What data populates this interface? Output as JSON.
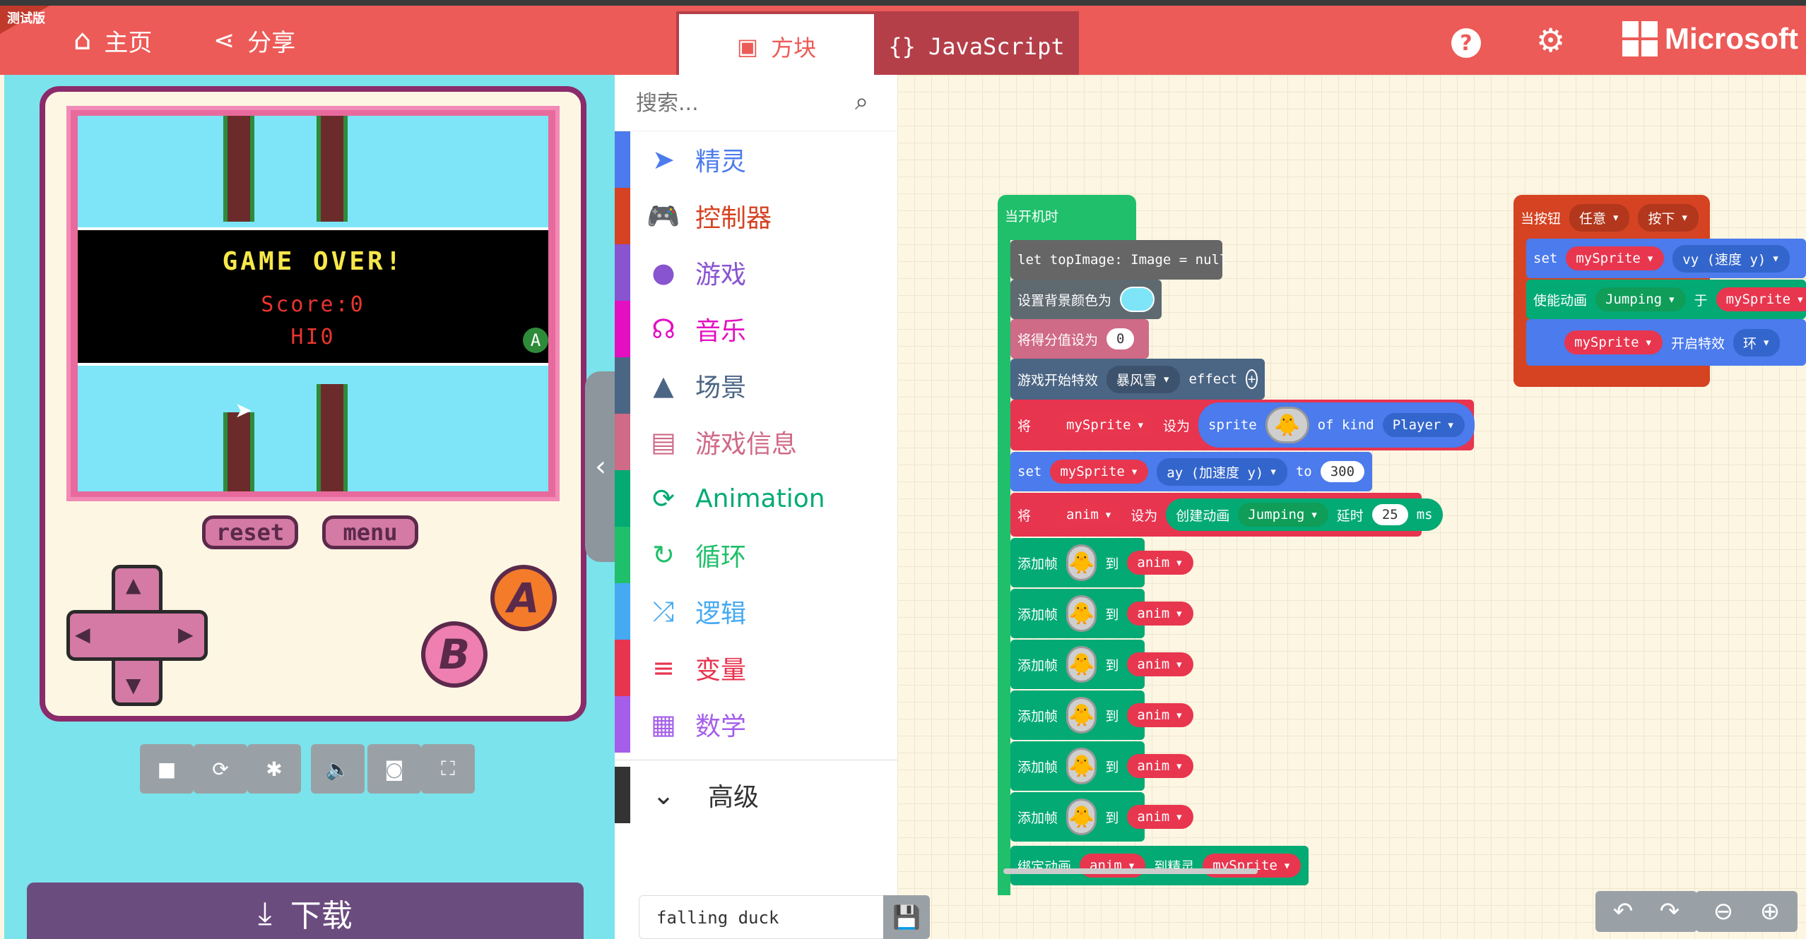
{
  "header": {
    "beta_label": "测试版",
    "home_label": "主页",
    "share_label": "分享",
    "tab_blocks": "方块",
    "tab_js": "JavaScript",
    "brand": "Microsoft",
    "accent": "#ec5b57"
  },
  "simulator": {
    "game_over": "GAME OVER!",
    "score": "Score:0",
    "hi": "HI0",
    "reset": "reset",
    "menu": "menu",
    "btn_a": "A",
    "btn_b": "B",
    "a_indicator": "A",
    "toolbar_icons": [
      "stop-icon",
      "restart-icon",
      "debug-icon",
      "sound-icon",
      "screenshot-icon",
      "fullscreen-icon"
    ],
    "download": "下载"
  },
  "toolbox": {
    "search_placeholder": "搜索...",
    "categories": [
      {
        "label": "精灵",
        "color": "#4b7bec",
        "icon": "paper-plane-icon"
      },
      {
        "label": "控制器",
        "color": "#d54322",
        "icon": "gamepad-icon"
      },
      {
        "label": "游戏",
        "color": "#8854d0",
        "icon": "circle-icon"
      },
      {
        "label": "音乐",
        "color": "#e30fc0",
        "icon": "headphones-icon"
      },
      {
        "label": "场景",
        "color": "#4b6584",
        "icon": "tree-icon"
      },
      {
        "label": "游戏信息",
        "color": "#cf6a87",
        "icon": "id-card-icon"
      },
      {
        "label": "Animation",
        "color": "#03aa74",
        "icon": "refresh-icon"
      },
      {
        "label": "循环",
        "color": "#20bf6b",
        "icon": "loop-icon"
      },
      {
        "label": "逻辑",
        "color": "#45aaf2",
        "icon": "shuffle-icon"
      },
      {
        "label": "变量",
        "color": "#e7344f",
        "icon": "list-icon"
      },
      {
        "label": "数学",
        "color": "#a55eea",
        "icon": "calculator-icon"
      }
    ],
    "advanced": "高级"
  },
  "workspace": {
    "on_start": "当开机时",
    "let_top": "let topImage: Image = null",
    "set_bg": "设置背景颜色为",
    "set_score": "将得分值设为",
    "score_val": "0",
    "effect_start": "游戏开始特效",
    "effect_name": "暴风雪",
    "effect_word": "effect",
    "set_word": "将",
    "var_mysprite": "mySprite",
    "to_word": "设为",
    "sprite_word": "sprite",
    "of_kind": "of kind",
    "kind_player": "Player",
    "set_en": "set",
    "ay_label": "ay (加速度 y)",
    "to_en": "to",
    "ay_val": "300",
    "var_anim": "anim",
    "create_anim": "创建动画",
    "jumping": "Jumping",
    "delay": "延时",
    "delay_val": "25",
    "ms": "ms",
    "add_frame": "添加帧",
    "to_cn": "到",
    "attach": "绑定动画",
    "to_sprite": "到精灵",
    "on_button": "当按钮",
    "any": "任意",
    "pressed": "按下",
    "vy_label": "vy (速度 y)",
    "run_anim": "使能动画",
    "on_cn": "于",
    "start_effect": "开启特效",
    "ring": "环"
  },
  "project_name": "falling duck"
}
